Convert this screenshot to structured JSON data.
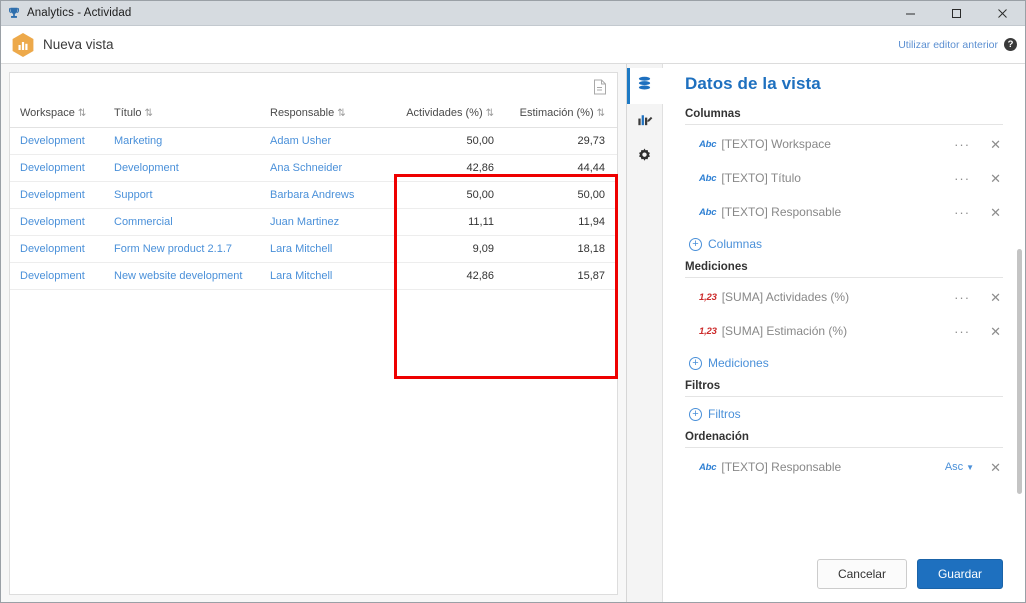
{
  "window": {
    "title": "Analytics - Actividad",
    "app_icon": "trophy-icon",
    "minimize_label": "─",
    "maximize_label": "□",
    "close_label": "✕"
  },
  "toolbar": {
    "view_icon": "bar-chart-hexagon-icon",
    "view_name": "Nueva vista",
    "previous_editor_link": "Utilizar editor anterior",
    "help_label": "?",
    "accent_orange": "#eda94a"
  },
  "canvas": {
    "export_icon": "document-export-icon",
    "table": {
      "columns": [
        {
          "label": "Workspace",
          "align": "left"
        },
        {
          "label": "Título",
          "align": "left"
        },
        {
          "label": "Responsable",
          "align": "left"
        },
        {
          "label": "Actividades (%)",
          "align": "right"
        },
        {
          "label": "Estimación (%)",
          "align": "right"
        }
      ],
      "sort_glyph": "⇅",
      "rows": [
        {
          "workspace": "Development",
          "titulo": "Marketing",
          "responsable": "Adam Usher",
          "actividades": "50,00",
          "estimacion": "29,73"
        },
        {
          "workspace": "Development",
          "titulo": "Development",
          "responsable": "Ana Schneider",
          "actividades": "42,86",
          "estimacion": "44,44"
        },
        {
          "workspace": "Development",
          "titulo": "Support",
          "responsable": "Barbara Andrews",
          "actividades": "50,00",
          "estimacion": "50,00"
        },
        {
          "workspace": "Development",
          "titulo": "Commercial",
          "responsable": "Juan Martinez",
          "actividades": "11,11",
          "estimacion": "11,94"
        },
        {
          "workspace": "Development",
          "titulo": "Form New product 2.1.7",
          "responsable": "Lara Mitchell",
          "actividades": "9,09",
          "estimacion": "18,18"
        },
        {
          "workspace": "Development",
          "titulo": "New website development",
          "responsable": "Lara Mitchell",
          "actividades": "42,86",
          "estimacion": "15,87"
        }
      ]
    },
    "highlight_color": "#ee0000"
  },
  "rightpanel": {
    "rail": [
      {
        "icon": "database-icon",
        "active": true
      },
      {
        "icon": "chart-edit-icon",
        "active": false
      },
      {
        "icon": "gear-icon",
        "active": false
      }
    ],
    "title": "Datos de la vista",
    "sections": [
      {
        "label": "Columnas",
        "fields": [
          {
            "type": "Abc",
            "type_kind": "abc",
            "name": "[TEXTO] Workspace",
            "menu": "···",
            "remove": "✕"
          },
          {
            "type": "Abc",
            "type_kind": "abc",
            "name": "[TEXTO] Título",
            "menu": "···",
            "remove": "✕"
          },
          {
            "type": "Abc",
            "type_kind": "abc",
            "name": "[TEXTO] Responsable",
            "menu": "···",
            "remove": "✕"
          }
        ],
        "add_label": "Columnas"
      },
      {
        "label": "Mediciones",
        "fields": [
          {
            "type": "1,23",
            "type_kind": "num",
            "name": "[SUMA] Actividades (%)",
            "menu": "···",
            "remove": "✕"
          },
          {
            "type": "1,23",
            "type_kind": "num",
            "name": "[SUMA] Estimación (%)",
            "menu": "···",
            "remove": "✕"
          }
        ],
        "add_label": "Mediciones"
      },
      {
        "label": "Filtros",
        "fields": [],
        "add_label": "Filtros"
      },
      {
        "label": "Ordenación",
        "fields": [
          {
            "type": "Abc",
            "type_kind": "abc",
            "name": "[TEXTO] Responsable",
            "sort_dir": "Asc",
            "caret": "▼",
            "remove": "✕"
          }
        ],
        "add_label": null
      }
    ],
    "cancel_label": "Cancelar",
    "save_label": "Guardar",
    "accent_blue": "#1e70bf"
  }
}
